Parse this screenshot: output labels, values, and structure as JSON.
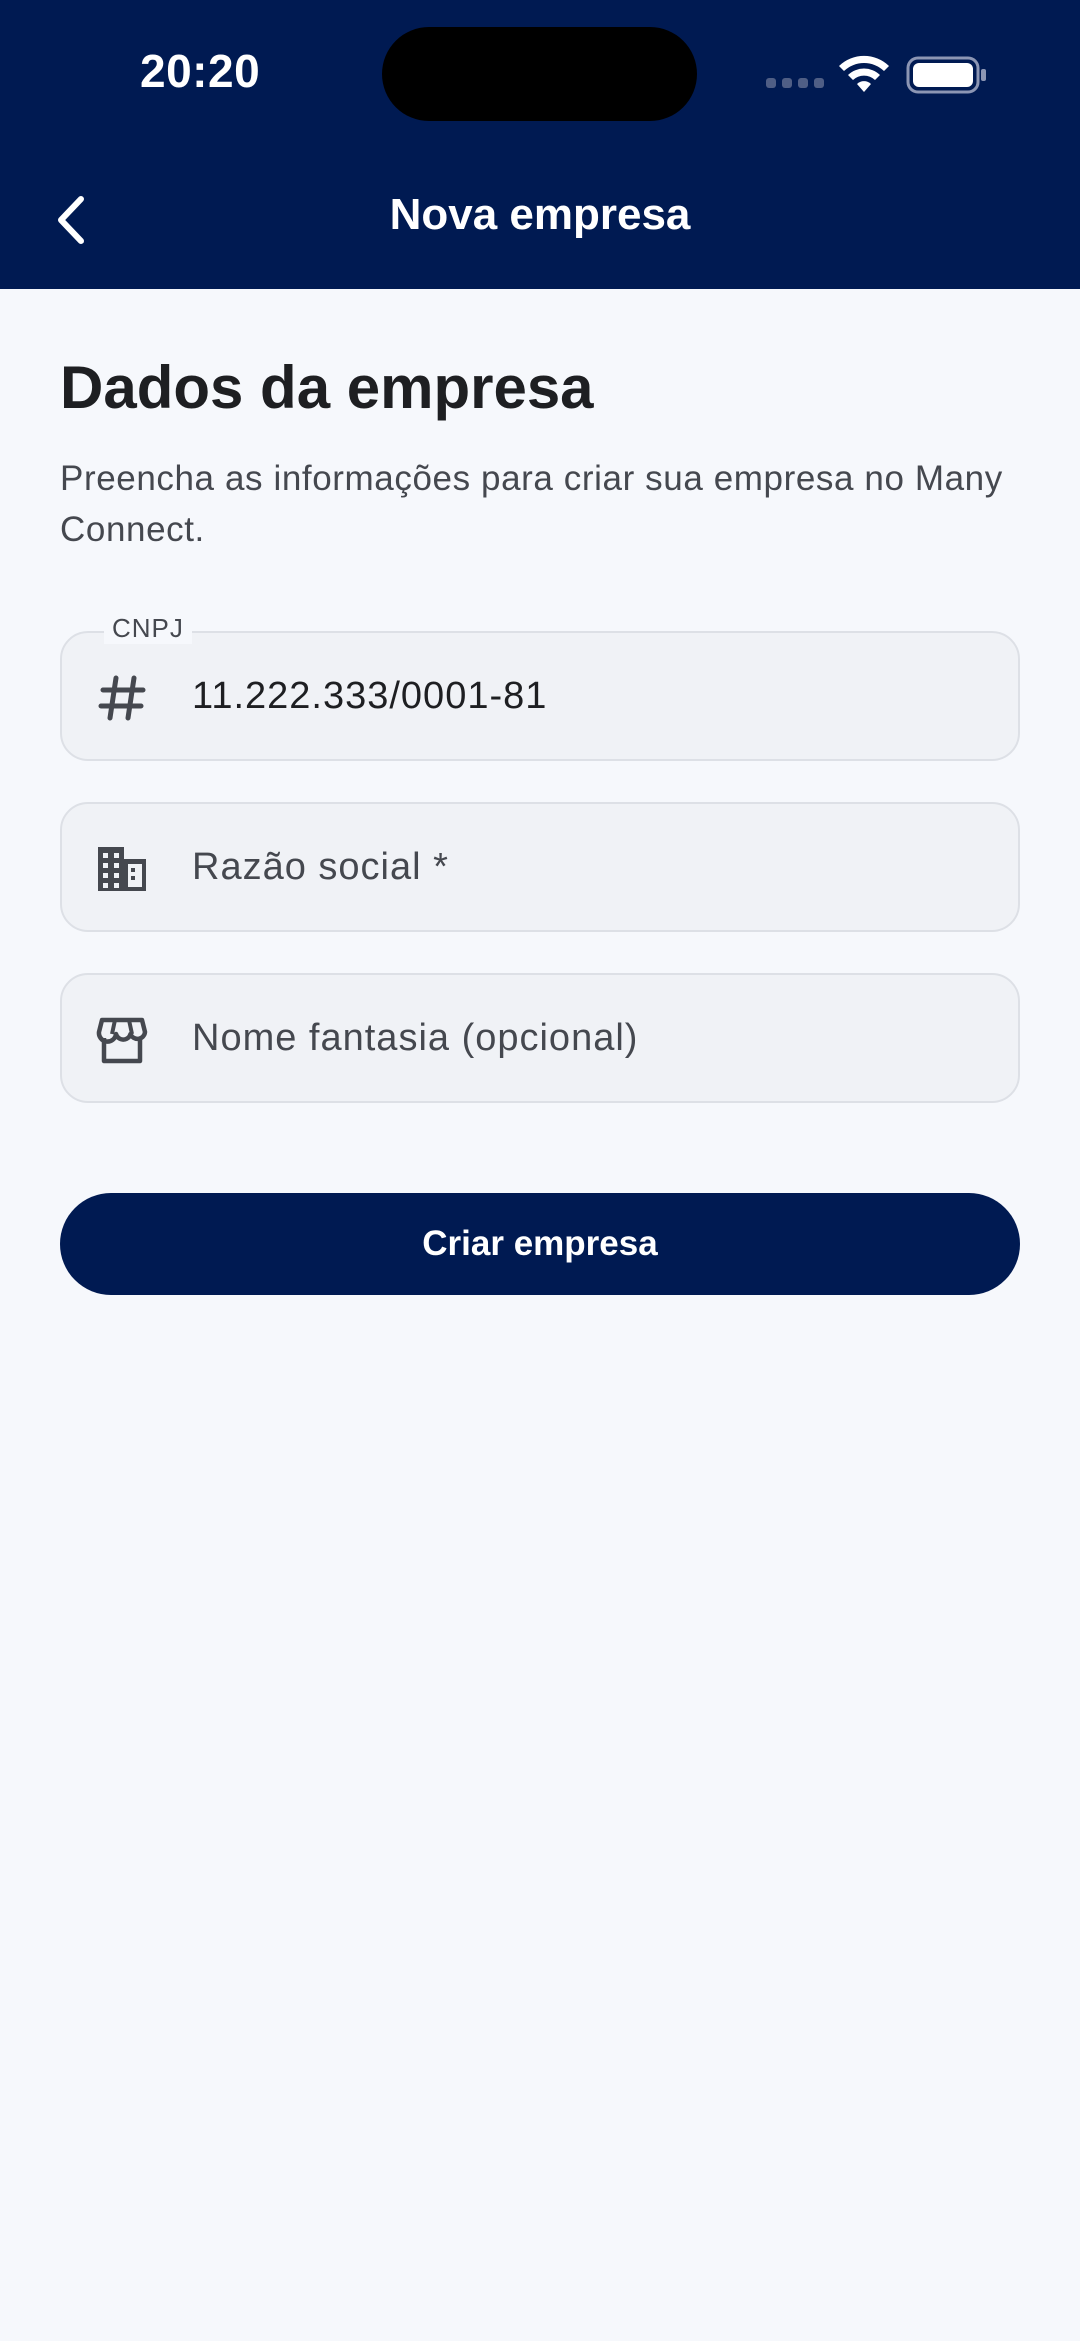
{
  "status_bar": {
    "time": "20:20"
  },
  "nav": {
    "title": "Nova empresa",
    "back_icon": "chevron-left-icon"
  },
  "form": {
    "title": "Dados da empresa",
    "subtitle": "Preencha as informações para criar sua empresa no Many Connect.",
    "fields": {
      "cnpj": {
        "label": "CNPJ",
        "value": "11.222.333/0001-81",
        "icon": "hash-icon"
      },
      "razao_social": {
        "placeholder": "Razão social *",
        "icon": "building-icon"
      },
      "nome_fantasia": {
        "placeholder": "Nome fantasia (opcional)",
        "icon": "store-icon"
      }
    },
    "submit_label": "Criar empresa"
  },
  "colors": {
    "primary": "#001A52",
    "background": "#F6F8FC",
    "field_bg": "#F0F2F6",
    "field_border": "#DDE0E6",
    "text": "#1E1F22",
    "muted_text": "#45484F"
  }
}
